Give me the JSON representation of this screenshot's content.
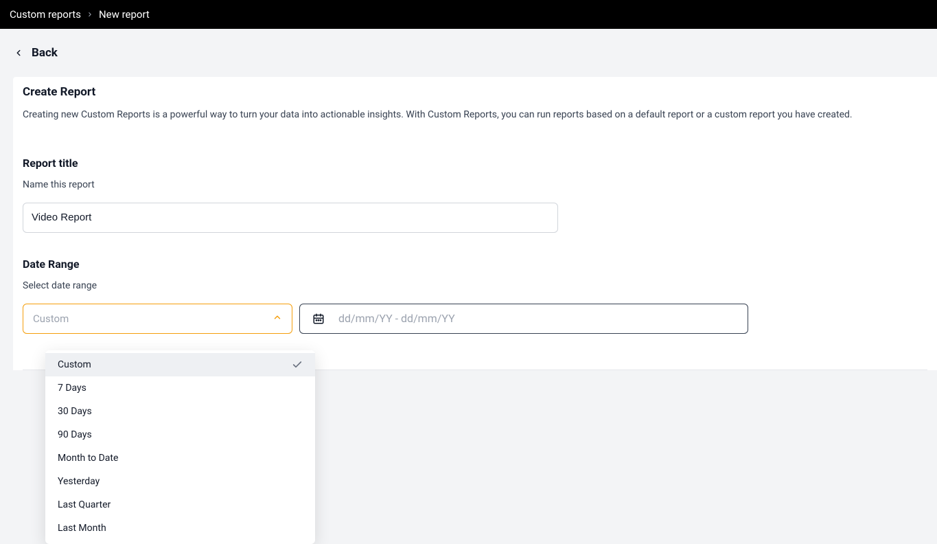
{
  "breadcrumb": {
    "parent": "Custom reports",
    "current": "New report"
  },
  "back": {
    "label": "Back"
  },
  "header": {
    "title": "Create Report",
    "description": "Creating new Custom Reports is a powerful way to turn your data into actionable insights. With Custom Reports, you can run reports based on a default report or a custom report you have created."
  },
  "title_section": {
    "heading": "Report title",
    "sublabel": "Name this report",
    "value": "Video Report"
  },
  "date_section": {
    "heading": "Date Range",
    "sublabel": "Select date range",
    "select_placeholder": "Custom",
    "date_placeholder": "dd/mm/YY - dd/mm/YY",
    "options": [
      {
        "label": "Custom",
        "selected": true
      },
      {
        "label": "7 Days",
        "selected": false
      },
      {
        "label": "30 Days",
        "selected": false
      },
      {
        "label": "90 Days",
        "selected": false
      },
      {
        "label": "Month to Date",
        "selected": false
      },
      {
        "label": "Yesterday",
        "selected": false
      },
      {
        "label": "Last Quarter",
        "selected": false
      },
      {
        "label": "Last Month",
        "selected": false
      }
    ]
  }
}
